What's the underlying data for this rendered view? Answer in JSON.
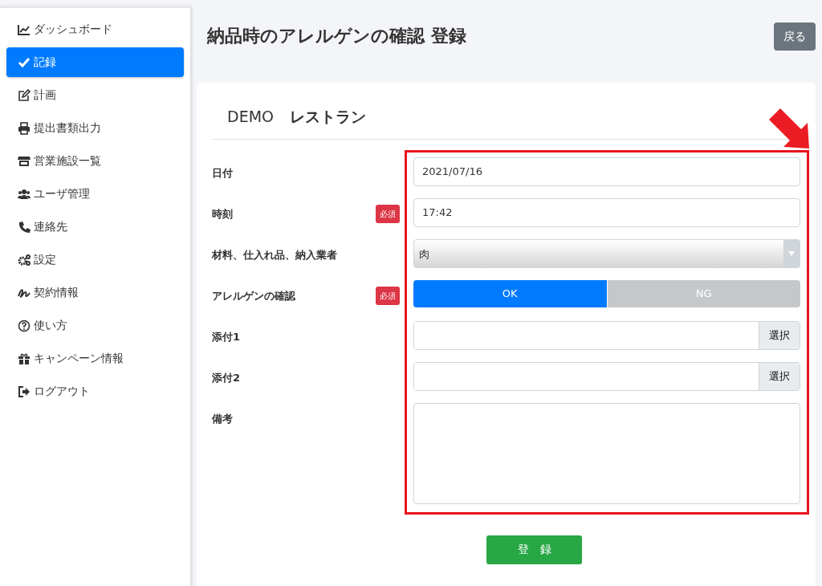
{
  "sidebar": {
    "items": [
      {
        "label": "ダッシュボード",
        "selected": false
      },
      {
        "label": "記録",
        "selected": true
      },
      {
        "label": "計画",
        "selected": false
      },
      {
        "label": "提出書類出力",
        "selected": false
      },
      {
        "label": "営業施設一覧",
        "selected": false
      },
      {
        "label": "ユーザ管理",
        "selected": false
      },
      {
        "label": "連絡先",
        "selected": false
      },
      {
        "label": "設定",
        "selected": false
      },
      {
        "label": "契約情報",
        "selected": false
      },
      {
        "label": "使い方",
        "selected": false
      },
      {
        "label": "キャンペーン情報",
        "selected": false
      },
      {
        "label": "ログアウト",
        "selected": false
      }
    ]
  },
  "page": {
    "title": "納品時のアレルゲンの確認 登録",
    "back_button": "戻る"
  },
  "form": {
    "facility_prefix": "DEMO",
    "facility_name": "レストラン",
    "fields": [
      {
        "kind": "input",
        "label": "日付",
        "value": "2021/07/16"
      },
      {
        "kind": "input",
        "label": "時刻",
        "badge": "必須",
        "value": "17:42"
      },
      {
        "kind": "select",
        "label": "材料、仕入れ品、納入業者",
        "value": "肉"
      },
      {
        "kind": "toggle",
        "label": "アレルゲンの確認",
        "badge": "必須",
        "options": [
          {
            "label": "OK",
            "selected": true
          },
          {
            "label": "NG",
            "selected": false
          }
        ]
      },
      {
        "kind": "file",
        "label": "添付1",
        "button": "選択"
      },
      {
        "kind": "file",
        "label": "添付2",
        "button": "選択"
      },
      {
        "kind": "textarea",
        "label": "備考"
      }
    ],
    "submit": "登　録"
  },
  "annotation": {
    "highlight": true,
    "arrow": true
  }
}
